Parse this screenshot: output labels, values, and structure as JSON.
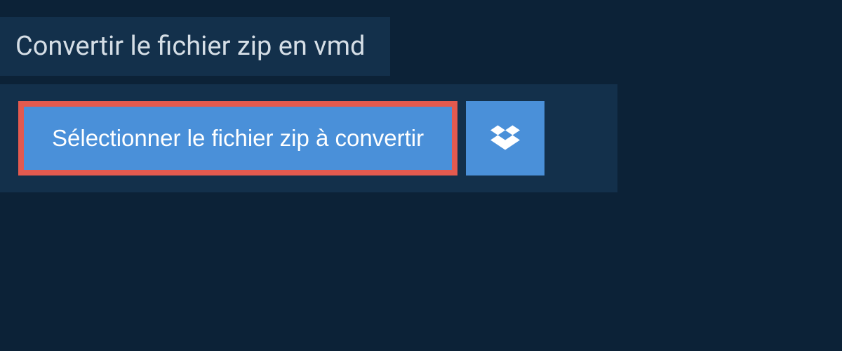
{
  "header": {
    "title": "Convertir le fichier zip en vmd"
  },
  "upload": {
    "select_button_label": "Sélectionner le fichier zip à convertir"
  }
}
